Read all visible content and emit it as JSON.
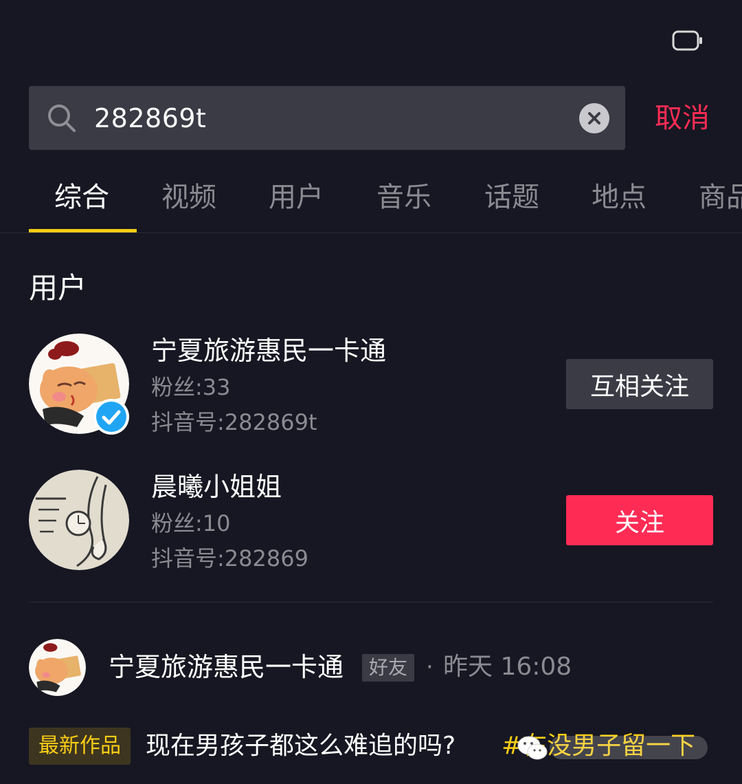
{
  "search": {
    "query": "282869t",
    "cancel_label": "取消"
  },
  "tabs": [
    {
      "label": "综合",
      "active": true
    },
    {
      "label": "视频",
      "active": false
    },
    {
      "label": "用户",
      "active": false
    },
    {
      "label": "音乐",
      "active": false
    },
    {
      "label": "话题",
      "active": false
    },
    {
      "label": "地点",
      "active": false
    },
    {
      "label": "商品",
      "active": false
    }
  ],
  "users_section": {
    "title": "用户",
    "users": [
      {
        "name": "宁夏旅游惠民一卡通",
        "fans": "粉丝:33",
        "douyin_id": "抖音号:282869t",
        "verified": true,
        "action_label": "互相关注"
      },
      {
        "name": "晨曦小姐姐",
        "fans": "粉丝:10",
        "douyin_id": "抖音号:282869",
        "verified": false,
        "action_label": "关注"
      }
    ]
  },
  "post": {
    "author": "宁夏旅游惠民一卡通",
    "badge": "好友",
    "dot": "·",
    "time": "昨天 16:08",
    "latest_badge": "最新作品",
    "text": "现在男孩子都这么难追的吗?",
    "tag": "#在没男子留一下"
  },
  "colors": {
    "background": "#161722",
    "accent_red": "#fe2c55",
    "accent_yellow": "#facd16",
    "muted_text": "#8a8b92",
    "chip_bg": "#3a3b45"
  }
}
